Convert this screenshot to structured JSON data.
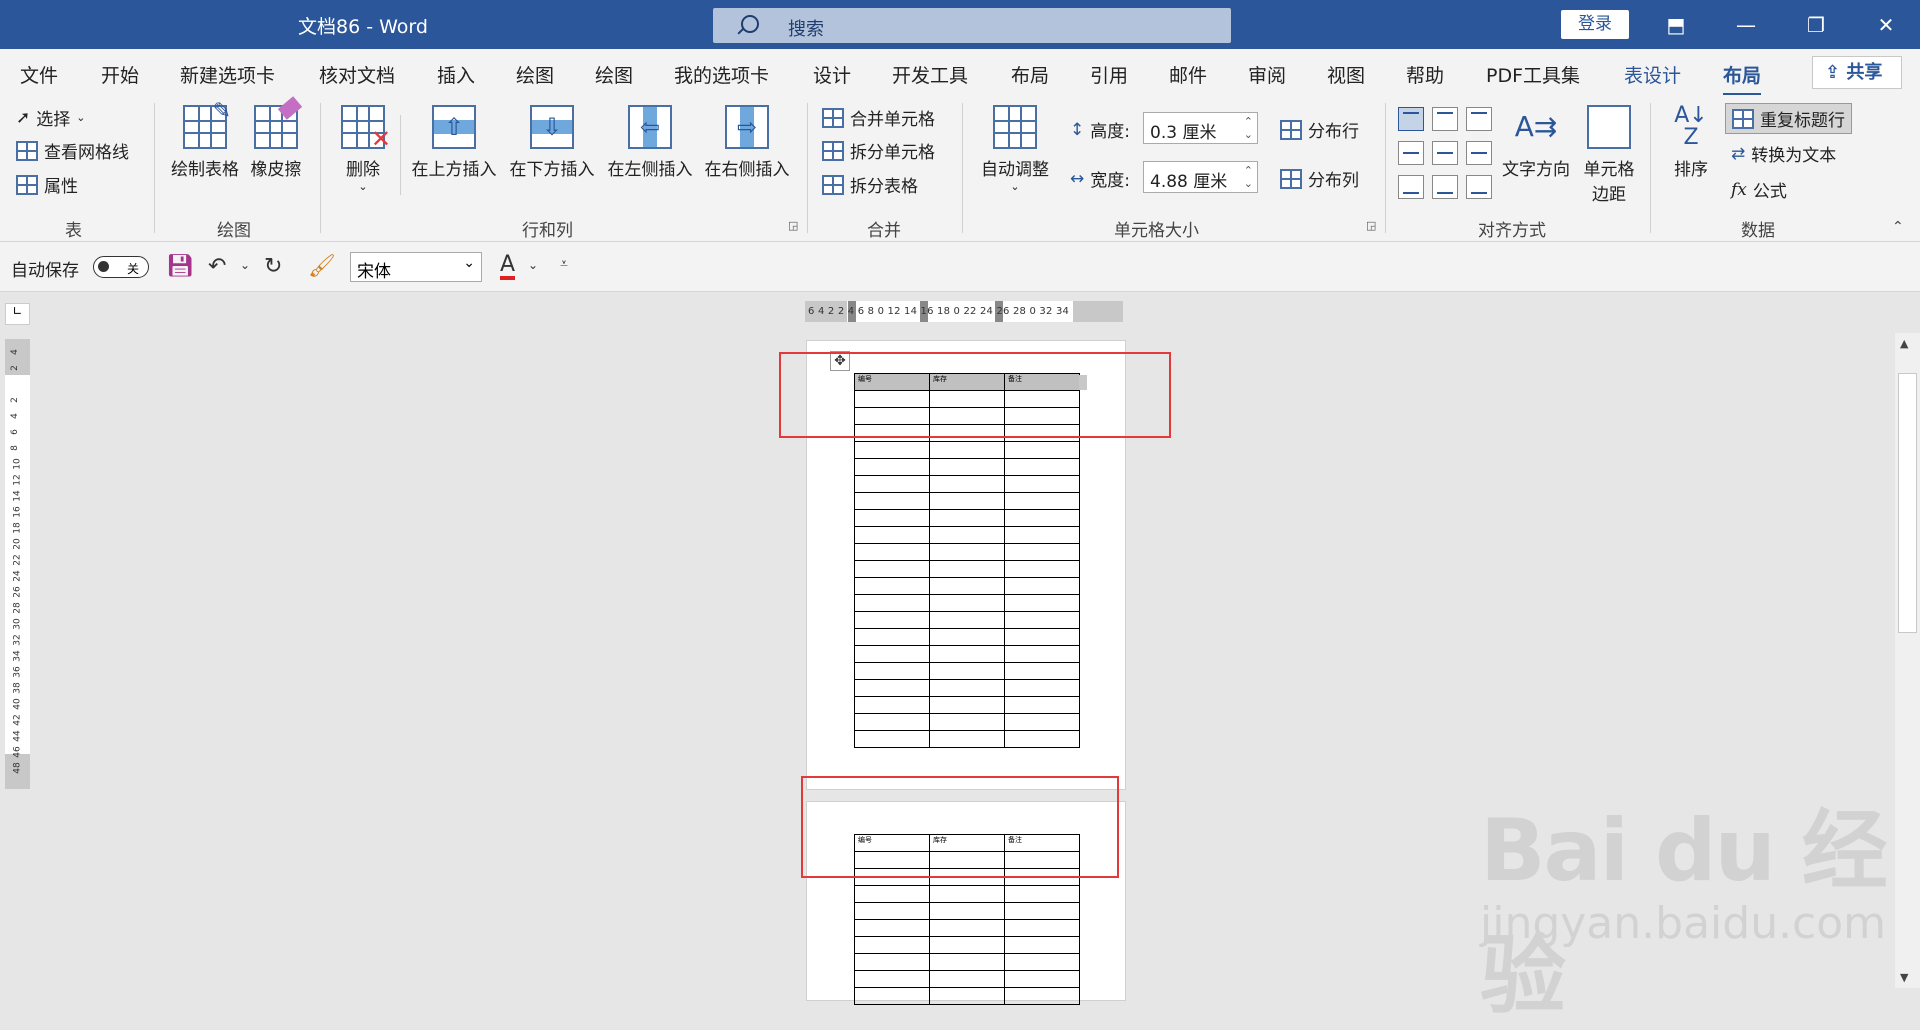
{
  "window": {
    "title": "文档86  -  Word",
    "search_placeholder": "搜索",
    "login_label": "登录",
    "share_label": "共享"
  },
  "tabs": [
    "文件",
    "开始",
    "新建选项卡",
    "核对文档",
    "插入",
    "绘图",
    "绘图",
    "我的选项卡",
    "设计",
    "开发工具",
    "布局",
    "引用",
    "邮件",
    "审阅",
    "视图",
    "帮助",
    "PDF工具集",
    "表设计",
    "布局"
  ],
  "ribbon": {
    "table_group": {
      "label": "表",
      "select": "选择",
      "gridlines": "查看网格线",
      "properties": "属性"
    },
    "draw_group": {
      "label": "绘图",
      "draw_table": "绘制表格",
      "eraser": "橡皮擦"
    },
    "rows_cols_group": {
      "label": "行和列",
      "delete": "删除",
      "insert_above": "在上方插入",
      "insert_below": "在下方插入",
      "insert_left": "在左侧插入",
      "insert_right": "在右侧插入"
    },
    "merge_group": {
      "label": "合并",
      "merge_cells": "合并单元格",
      "split_cells": "拆分单元格",
      "split_table": "拆分表格"
    },
    "cell_size_group": {
      "label": "单元格大小",
      "autofit": "自动调整",
      "height_label": "高度:",
      "height_value": "0.3 厘米",
      "width_label": "宽度:",
      "width_value": "4.88 厘米",
      "distribute_rows": "分布行",
      "distribute_cols": "分布列"
    },
    "alignment_group": {
      "label": "对齐方式",
      "text_direction": "文字方向",
      "cell_margins_1": "单元格",
      "cell_margins_2": "边距"
    },
    "data_group": {
      "label": "数据",
      "sort": "排序",
      "repeat_header": "重复标题行",
      "convert_text": "转换为文本",
      "formula": "公式"
    }
  },
  "qat": {
    "autosave": "自动保存",
    "autosave_state": "关",
    "font_name": "宋体"
  },
  "ruler": {
    "h_ticks": "6  4  2       2  4  6  8    0 12 14 16 18    0 22 24 26 28    0 32 34"
  },
  "document": {
    "headers": [
      "编号",
      "库存",
      "备注"
    ],
    "page1_rows": 21,
    "page2_rows": 9
  },
  "watermark": {
    "brand": "Bai du 经验",
    "url": "jingyan.baidu.com"
  }
}
